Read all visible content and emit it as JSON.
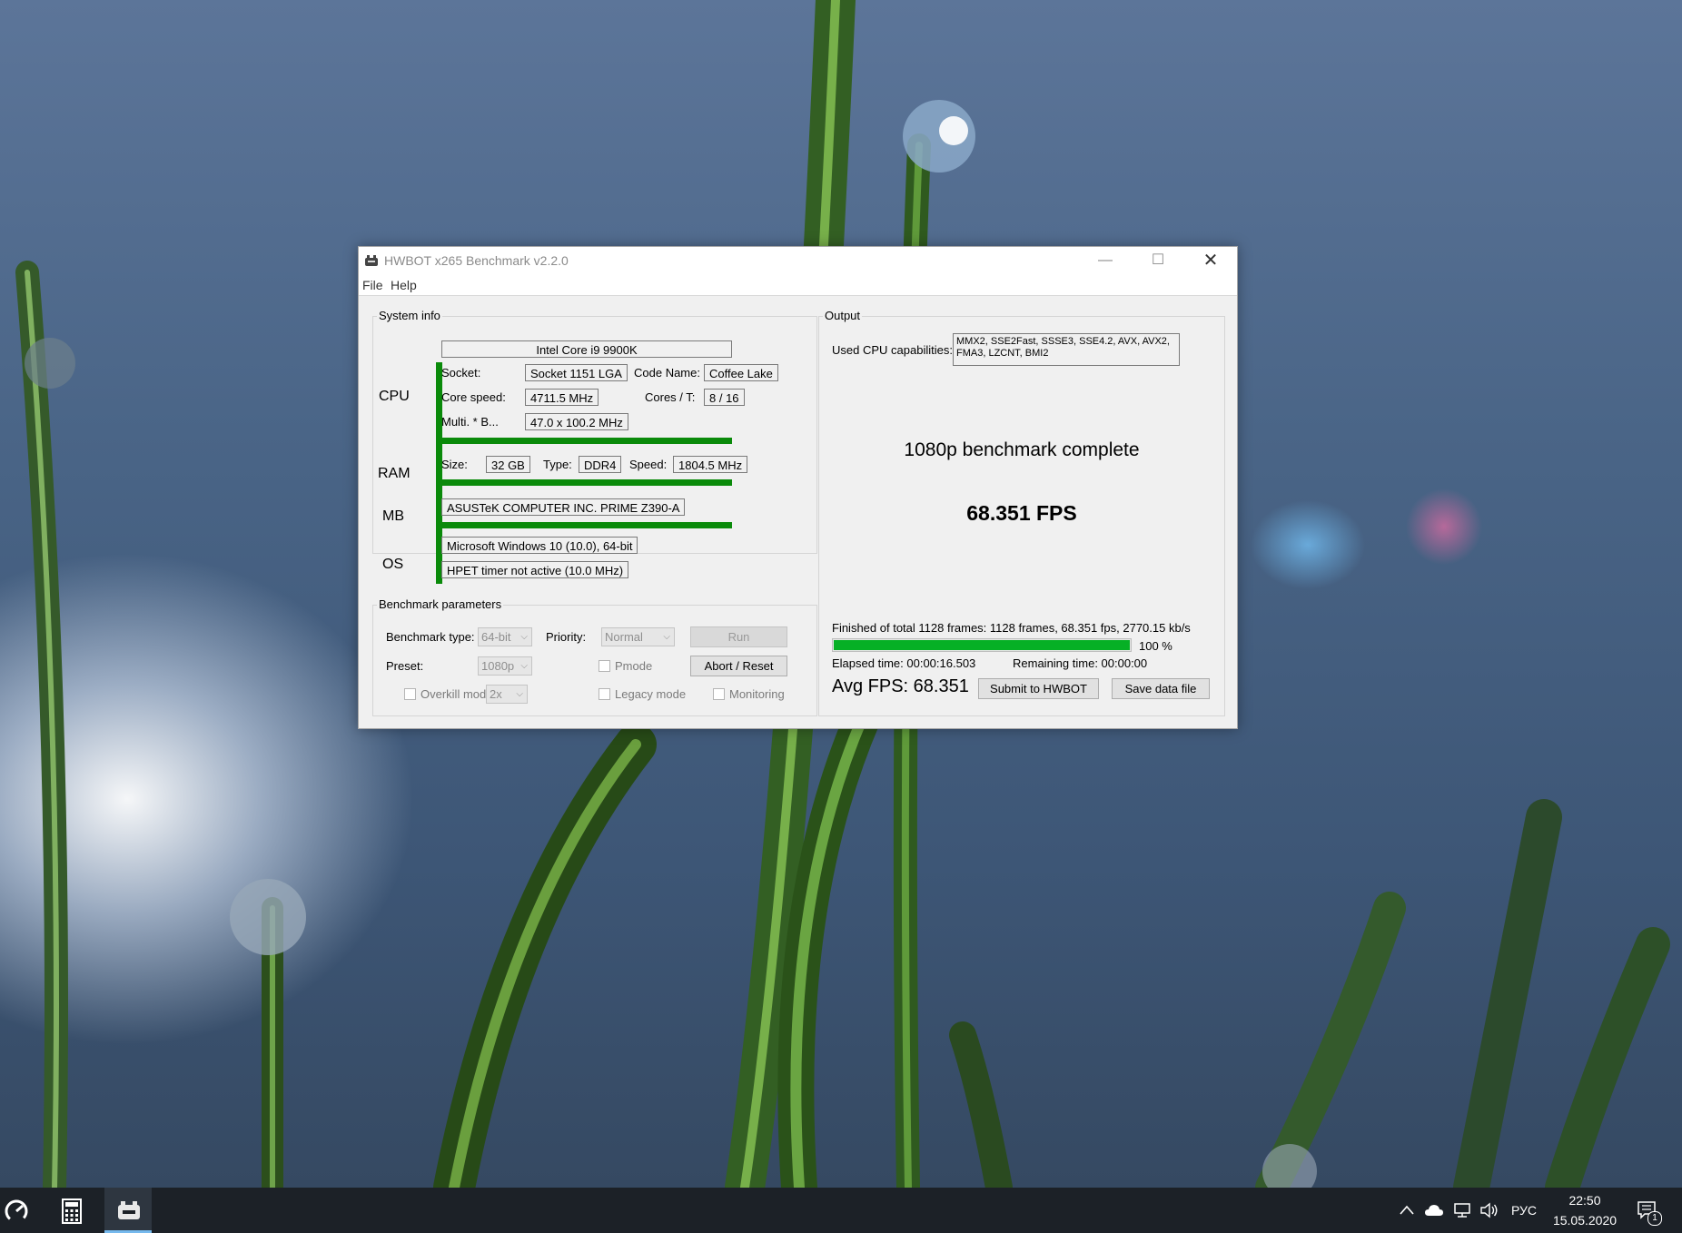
{
  "window": {
    "title": "HWBOT x265 Benchmark v2.2.0",
    "menu": [
      "File",
      "Help"
    ]
  },
  "system_info": {
    "group_label": "System info",
    "cpu_label": "CPU",
    "ram_label": "RAM",
    "mb_label": "MB",
    "os_label": "OS",
    "cpu_name": "Intel Core i9 9900K",
    "socket_label": "Socket:",
    "socket_value": "Socket 1151 LGA",
    "code_name_label": "Code Name:",
    "code_name_value": "Coffee Lake",
    "core_speed_label": "Core speed:",
    "core_speed_value": "4711.5 MHz",
    "cores_label": "Cores / T:",
    "cores_value": "8 / 16",
    "multi_label": "Multi. * B...",
    "multi_value": "47.0 x 100.2 MHz",
    "ram_size_label": "Size:",
    "ram_size_value": "32 GB",
    "ram_type_label": "Type:",
    "ram_type_value": "DDR4",
    "ram_speed_label": "Speed:",
    "ram_speed_value": "1804.5 MHz",
    "mb_value": "ASUSTeK COMPUTER INC. PRIME Z390-A",
    "os_value": "Microsoft Windows 10 (10.0), 64-bit",
    "timer_value": "HPET timer not active (10.0 MHz)"
  },
  "benchmark_params": {
    "group_label": "Benchmark parameters",
    "type_label": "Benchmark type:",
    "type_value": "64-bit",
    "priority_label": "Priority:",
    "priority_value": "Normal",
    "run_label": "Run",
    "preset_label": "Preset:",
    "preset_value": "1080p",
    "pmode_label": "Pmode",
    "abort_label": "Abort / Reset",
    "overkill_label": "Overkill mode",
    "overkill_value": "2x",
    "legacy_label": "Legacy mode",
    "monitoring_label": "Monitoring"
  },
  "output": {
    "group_label": "Output",
    "cap_label": "Used CPU capabilities:",
    "cap_line1": "MMX2, SSE2Fast, SSSE3, SSE4.2, AVX, AVX2,",
    "cap_line2": "FMA3, LZCNT, BMI2",
    "status": "1080p benchmark complete",
    "fps": "68.351 FPS",
    "finished": "Finished of total 1128 frames: 1128 frames, 68.351 fps,  2770.15 kb/s",
    "progress": 1.0,
    "progress_text": "100 %",
    "elapsed": "Elapsed time: 00:00:16.503",
    "remaining": "Remaining time: 00:00:00",
    "avg_fps": "Avg FPS: 68.351",
    "submit_label": "Submit to HWBOT",
    "save_label": "Save data file"
  },
  "taskbar": {
    "icons": [
      "power-gauge-icon",
      "calculator-icon",
      "hwbot-app-icon"
    ],
    "tray_icons": [
      "chevron-up-icon",
      "onedrive-cloud-icon",
      "network-icon",
      "volume-icon",
      "notification-icon"
    ],
    "language": "РУС",
    "time": "22:50",
    "date": "15.05.2020",
    "notification_count": "1"
  },
  "colors": {
    "accent_green": "#0a8a0a",
    "progress_green": "#06b025",
    "taskbar": "#1c2127"
  }
}
